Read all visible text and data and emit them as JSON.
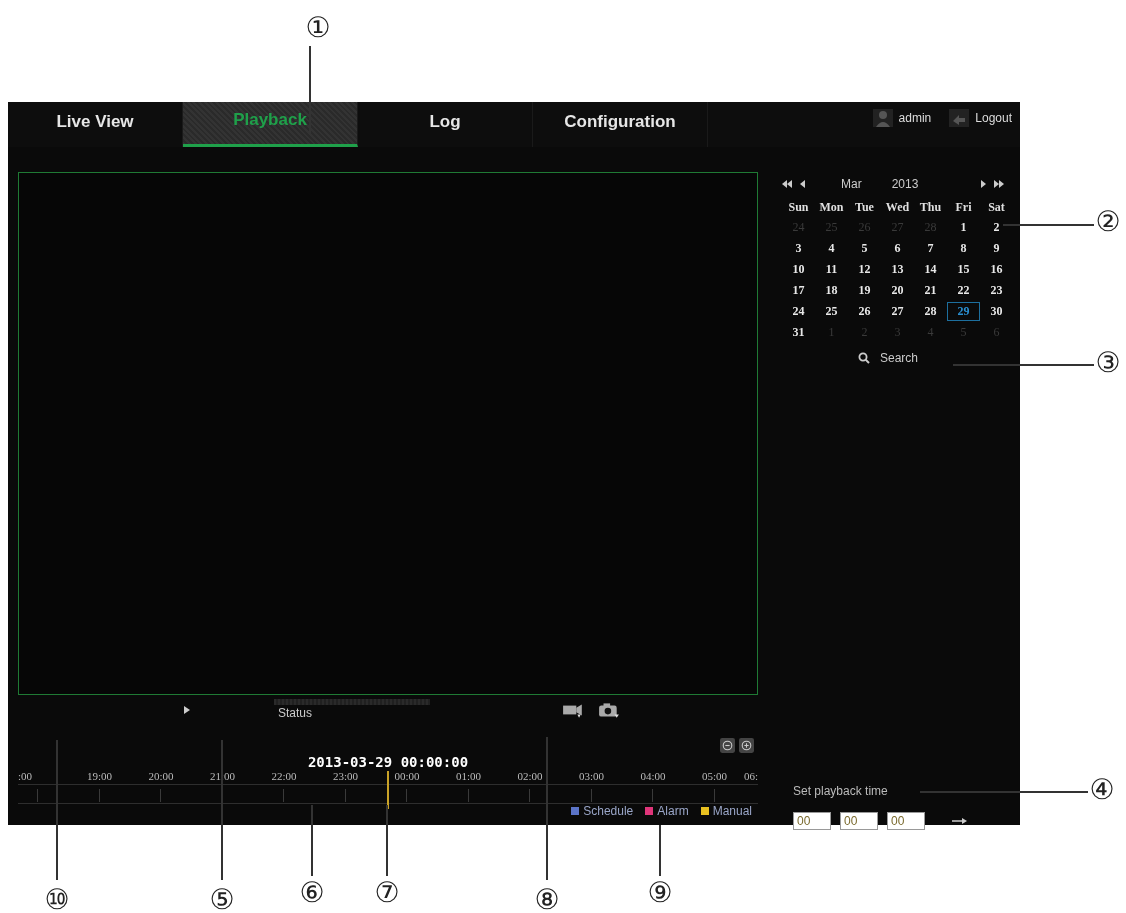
{
  "tabs": [
    {
      "label": "Live View",
      "selected": false
    },
    {
      "label": "Playback",
      "selected": true
    },
    {
      "label": "Log",
      "selected": false
    },
    {
      "label": "Configuration",
      "selected": false
    }
  ],
  "user": {
    "name": "admin",
    "logout": "Logout"
  },
  "calendar": {
    "month": "Mar",
    "year": "2013",
    "weekdays": [
      "Sun",
      "Mon",
      "Tue",
      "Wed",
      "Thu",
      "Fri",
      "Sat"
    ],
    "days": [
      {
        "label": "24",
        "other_month": true,
        "selected": false
      },
      {
        "label": "25",
        "other_month": true,
        "selected": false
      },
      {
        "label": "26",
        "other_month": true,
        "selected": false
      },
      {
        "label": "27",
        "other_month": true,
        "selected": false
      },
      {
        "label": "28",
        "other_month": true,
        "selected": false
      },
      {
        "label": "1",
        "other_month": false,
        "selected": false
      },
      {
        "label": "2",
        "other_month": false,
        "selected": false
      },
      {
        "label": "3",
        "other_month": false,
        "selected": false
      },
      {
        "label": "4",
        "other_month": false,
        "selected": false
      },
      {
        "label": "5",
        "other_month": false,
        "selected": false
      },
      {
        "label": "6",
        "other_month": false,
        "selected": false
      },
      {
        "label": "7",
        "other_month": false,
        "selected": false
      },
      {
        "label": "8",
        "other_month": false,
        "selected": false
      },
      {
        "label": "9",
        "other_month": false,
        "selected": false
      },
      {
        "label": "10",
        "other_month": false,
        "selected": false
      },
      {
        "label": "11",
        "other_month": false,
        "selected": false
      },
      {
        "label": "12",
        "other_month": false,
        "selected": false
      },
      {
        "label": "13",
        "other_month": false,
        "selected": false
      },
      {
        "label": "14",
        "other_month": false,
        "selected": false
      },
      {
        "label": "15",
        "other_month": false,
        "selected": false
      },
      {
        "label": "16",
        "other_month": false,
        "selected": false
      },
      {
        "label": "17",
        "other_month": false,
        "selected": false
      },
      {
        "label": "18",
        "other_month": false,
        "selected": false
      },
      {
        "label": "19",
        "other_month": false,
        "selected": false
      },
      {
        "label": "20",
        "other_month": false,
        "selected": false
      },
      {
        "label": "21",
        "other_month": false,
        "selected": false
      },
      {
        "label": "22",
        "other_month": false,
        "selected": false
      },
      {
        "label": "23",
        "other_month": false,
        "selected": false
      },
      {
        "label": "24",
        "other_month": false,
        "selected": false
      },
      {
        "label": "25",
        "other_month": false,
        "selected": false
      },
      {
        "label": "26",
        "other_month": false,
        "selected": false
      },
      {
        "label": "27",
        "other_month": false,
        "selected": false
      },
      {
        "label": "28",
        "other_month": false,
        "selected": false
      },
      {
        "label": "29",
        "other_month": false,
        "selected": true
      },
      {
        "label": "30",
        "other_month": false,
        "selected": false
      },
      {
        "label": "31",
        "other_month": false,
        "selected": false
      },
      {
        "label": "1",
        "other_month": true,
        "selected": false
      },
      {
        "label": "2",
        "other_month": true,
        "selected": false
      },
      {
        "label": "3",
        "other_month": true,
        "selected": false
      },
      {
        "label": "4",
        "other_month": true,
        "selected": false
      },
      {
        "label": "5",
        "other_month": true,
        "selected": false
      },
      {
        "label": "6",
        "other_month": true,
        "selected": false
      }
    ]
  },
  "search": {
    "label": "Search"
  },
  "controls": {
    "status": "Status"
  },
  "timeline": {
    "datetime": "2013-03-29 00:00:00",
    "hours": [
      ":00",
      "19:00",
      "20:00",
      "21:00",
      "22:00",
      "23:00",
      "00:00",
      "01:00",
      "02:00",
      "03:00",
      "04:00",
      "05:00",
      "06:"
    ],
    "legend": [
      {
        "label": "Schedule",
        "color": "#5b74c8"
      },
      {
        "label": "Alarm",
        "color": "#e0357a"
      },
      {
        "label": "Manual",
        "color": "#e8c020"
      }
    ]
  },
  "playback_time": {
    "label": "Set playback time",
    "fields": [
      "00",
      "00",
      "00"
    ]
  },
  "callouts": [
    "①",
    "②",
    "③",
    "④",
    "⑩",
    "⑤",
    "⑥",
    "⑦",
    "⑧",
    "⑨"
  ]
}
